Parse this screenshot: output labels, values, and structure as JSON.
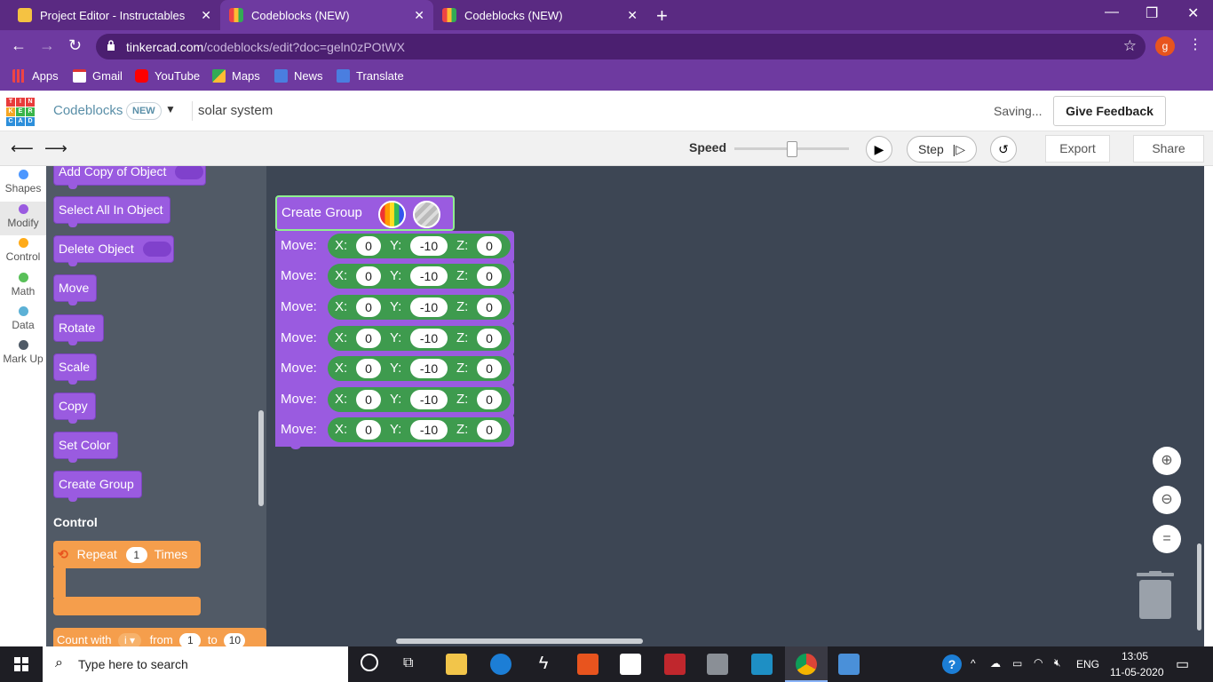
{
  "browser": {
    "tabs": [
      {
        "title": "Project Editor - Instructables",
        "active": false
      },
      {
        "title": "Codeblocks (NEW)",
        "active": true
      },
      {
        "title": "Codeblocks (NEW)",
        "active": false
      }
    ],
    "url_domain": "tinkercad.com",
    "url_path": "/codeblocks/edit?doc=geln0zPOtWX",
    "profile_initial": "g",
    "bookmarks": [
      "Apps",
      "Gmail",
      "YouTube",
      "Maps",
      "News",
      "Translate"
    ]
  },
  "header": {
    "logo_letters": [
      "T",
      "I",
      "N",
      "K",
      "E",
      "R",
      "C",
      "A",
      "D"
    ],
    "app_name": "Codeblocks",
    "badge": "NEW",
    "project_name": "solar system",
    "status": "Saving...",
    "feedback": "Give Feedback"
  },
  "toolbar": {
    "speed_label": "Speed",
    "speed_level": 0.5,
    "step_label": "Step",
    "export": "Export",
    "share": "Share"
  },
  "categories": [
    {
      "label": "Shapes",
      "color": "#4c97ff"
    },
    {
      "label": "Modify",
      "color": "#9a5be0"
    },
    {
      "label": "Control",
      "color": "#ffab19"
    },
    {
      "label": "Math",
      "color": "#59c059"
    },
    {
      "label": "Data",
      "color": "#5cb1d6"
    },
    {
      "label": "Mark Up",
      "color": "#4f5a66"
    }
  ],
  "palette": {
    "blocks": [
      "Add Copy of Object",
      "Select All In Object",
      "Delete Object",
      "Move",
      "Rotate",
      "Scale",
      "Copy",
      "Set Color",
      "Create Group"
    ],
    "control_heading": "Control",
    "repeat_label": "Repeat",
    "repeat_value": "1",
    "repeat_times": "Times",
    "count_label": "Count with",
    "count_var": "i",
    "count_from": "from",
    "count_from_val": "1",
    "count_to": "to",
    "count_to_val": "10"
  },
  "workspace": {
    "group_label": "Create Group",
    "move_label": "Move:",
    "axis_x": "X:",
    "axis_y": "Y:",
    "axis_z": "Z:",
    "moves": [
      {
        "x": "0",
        "y": "-10",
        "z": "0"
      },
      {
        "x": "0",
        "y": "-10",
        "z": "0"
      },
      {
        "x": "0",
        "y": "-10",
        "z": "0"
      },
      {
        "x": "0",
        "y": "-10",
        "z": "0"
      },
      {
        "x": "0",
        "y": "-10",
        "z": "0"
      },
      {
        "x": "0",
        "y": "-10",
        "z": "0"
      },
      {
        "x": "0",
        "y": "-10",
        "z": "0"
      }
    ]
  },
  "taskbar": {
    "search_placeholder": "Type here to search",
    "lang": "ENG",
    "time": "13:05",
    "date": "11-05-2020"
  }
}
